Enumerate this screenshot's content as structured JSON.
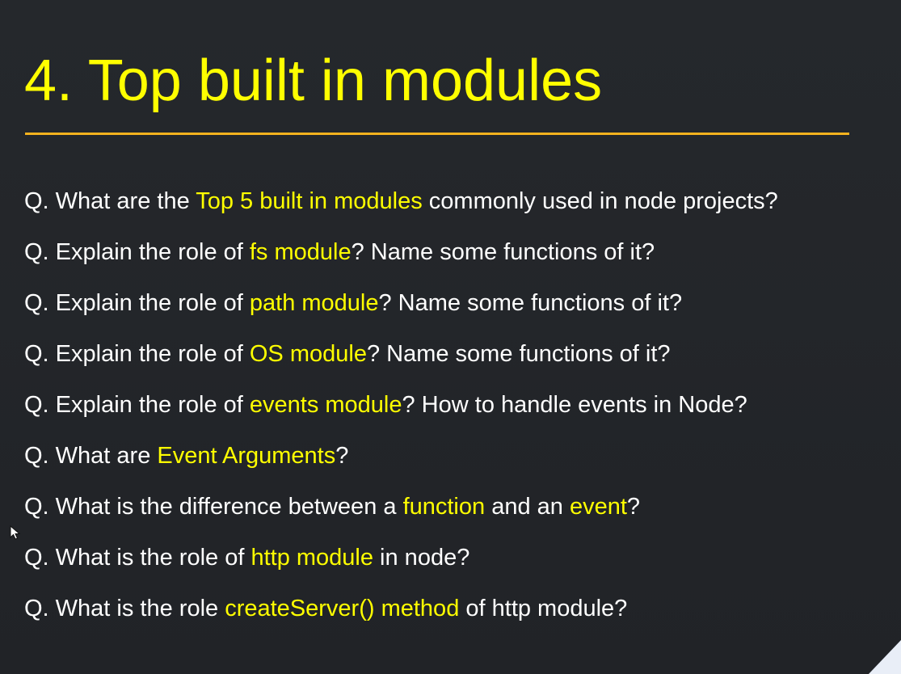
{
  "slide": {
    "title": "4. Top built in modules",
    "questions": [
      {
        "segments": [
          {
            "text": "Q. What are the ",
            "highlight": false
          },
          {
            "text": "Top 5 built in modules",
            "highlight": true
          },
          {
            "text": " commonly used in node projects?",
            "highlight": false
          }
        ]
      },
      {
        "segments": [
          {
            "text": "Q. Explain the role of ",
            "highlight": false
          },
          {
            "text": "fs module",
            "highlight": true
          },
          {
            "text": "? Name some functions of it?",
            "highlight": false
          }
        ]
      },
      {
        "segments": [
          {
            "text": "Q. Explain the role of ",
            "highlight": false
          },
          {
            "text": "path module",
            "highlight": true
          },
          {
            "text": "? Name some functions of it?",
            "highlight": false
          }
        ]
      },
      {
        "segments": [
          {
            "text": "Q. Explain the role of ",
            "highlight": false
          },
          {
            "text": "OS module",
            "highlight": true
          },
          {
            "text": "? Name some functions of it?",
            "highlight": false
          }
        ]
      },
      {
        "segments": [
          {
            "text": "Q. Explain the role of ",
            "highlight": false
          },
          {
            "text": "events module",
            "highlight": true
          },
          {
            "text": "? How to handle events in Node?",
            "highlight": false
          }
        ]
      },
      {
        "segments": [
          {
            "text": "Q. What are ",
            "highlight": false
          },
          {
            "text": "Event Arguments",
            "highlight": true
          },
          {
            "text": "?",
            "highlight": false
          }
        ]
      },
      {
        "segments": [
          {
            "text": "Q. What is the difference between a ",
            "highlight": false
          },
          {
            "text": "function",
            "highlight": true
          },
          {
            "text": " and an ",
            "highlight": false
          },
          {
            "text": "event",
            "highlight": true
          },
          {
            "text": "?",
            "highlight": false
          }
        ]
      },
      {
        "segments": [
          {
            "text": "Q. What is the role of ",
            "highlight": false
          },
          {
            "text": "http module",
            "highlight": true
          },
          {
            "text": " in node?",
            "highlight": false
          }
        ]
      },
      {
        "segments": [
          {
            "text": "Q. What is the role ",
            "highlight": false
          },
          {
            "text": "createServer() method",
            "highlight": true
          },
          {
            "text": " of http module?",
            "highlight": false
          }
        ]
      }
    ]
  },
  "colors": {
    "background": "#222529",
    "title": "#ffff00",
    "rule": "#f5b21e",
    "text": "#ffffff",
    "highlight": "#ffff00"
  },
  "icons": {
    "cursor": "mouse-pointer-icon",
    "corner": "page-curl-icon"
  }
}
